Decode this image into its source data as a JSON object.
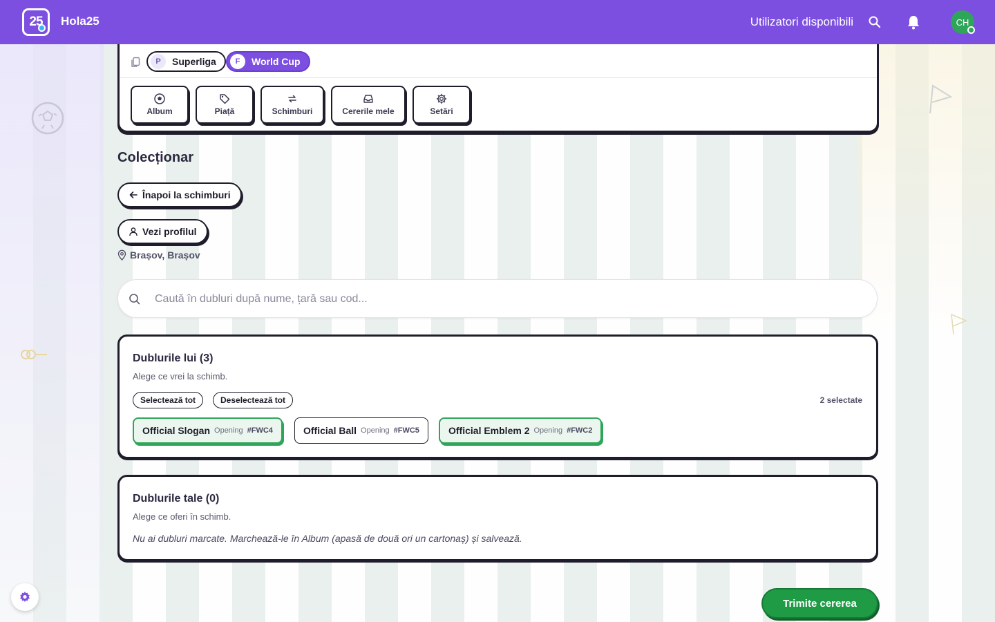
{
  "app": {
    "logo_text": "25",
    "brand": "Hola25",
    "available_users": "Utilizatori disponibili",
    "avatar_initials": "CH"
  },
  "leagues": [
    {
      "badge": "P",
      "label": "Superliga",
      "active": false
    },
    {
      "badge": "F",
      "label": "World Cup",
      "active": true
    }
  ],
  "nav": {
    "album": "Album",
    "market": "Piață",
    "trades": "Schimburi",
    "requests": "Cererile mele",
    "settings": "Setări"
  },
  "page": {
    "title": "Colecționar",
    "back_label": "Înapoi la schimburi",
    "profile_label": "Vezi profilul",
    "location": "Brașov, Brașov"
  },
  "search": {
    "placeholder": "Caută în dubluri după nume, țară sau cod...",
    "value": ""
  },
  "his_duplicates": {
    "title": "Dublurile lui (3)",
    "subtitle": "Alege ce vrei la schimb.",
    "select_all": "Selectează tot",
    "deselect_all": "Deselectează tot",
    "selected_count": "2 selectate",
    "items": [
      {
        "name": "Official Slogan",
        "set": "Opening",
        "code": "#FWC4",
        "selected": true
      },
      {
        "name": "Official Ball",
        "set": "Opening",
        "code": "#FWC5",
        "selected": false
      },
      {
        "name": "Official Emblem 2",
        "set": "Opening",
        "code": "#FWC2",
        "selected": true
      }
    ]
  },
  "your_duplicates": {
    "title": "Dublurile tale (0)",
    "subtitle": "Alege ce oferi în schimb.",
    "empty_note": "Nu ai dubluri marcate. Marchează-le în Album (apasă de două ori un cartonaș) și salvează."
  },
  "actions": {
    "send_request": "Trimite cererea"
  },
  "colors": {
    "topbar": "#7c4fe0",
    "selected_green": "#2fa55a",
    "primary_action": "#1f9a45"
  }
}
